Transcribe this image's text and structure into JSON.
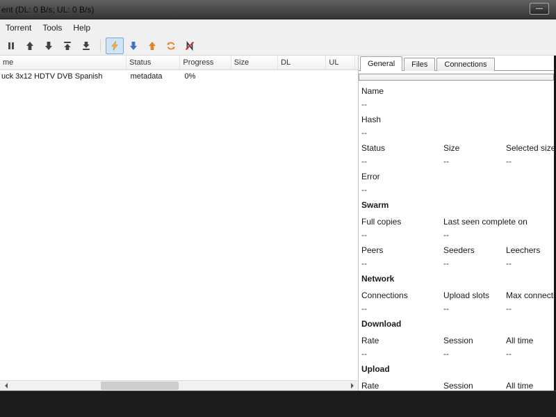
{
  "window": {
    "title": "ent (DL: 0 B/s; UL: 0 B/s)",
    "minimize_glyph": "—"
  },
  "menu": {
    "items": [
      "Torrent",
      "Tools",
      "Help"
    ]
  },
  "toolbar": {
    "buttons": [
      {
        "name": "pause-button",
        "icon": "pause-icon",
        "pressed": false
      },
      {
        "name": "queue-up-button",
        "icon": "arrow-up-icon",
        "pressed": false
      },
      {
        "name": "queue-down-button",
        "icon": "arrow-down-icon",
        "pressed": false
      },
      {
        "name": "queue-top-button",
        "icon": "arrow-top-icon",
        "pressed": false
      },
      {
        "name": "queue-bottom-button",
        "icon": "arrow-bottom-icon",
        "pressed": false
      },
      {
        "name": "turbo-toggle-button",
        "icon": "lightning-icon",
        "pressed": true
      },
      {
        "name": "download-button",
        "icon": "blue-down-arrow-icon",
        "pressed": false
      },
      {
        "name": "upload-button",
        "icon": "orange-up-arrow-icon",
        "pressed": false
      },
      {
        "name": "reannounce-button",
        "icon": "refresh-icon",
        "pressed": false
      },
      {
        "name": "remove-button",
        "icon": "ban-icon",
        "pressed": false
      }
    ]
  },
  "torrents": {
    "columns": [
      "me",
      "Status",
      "Progress",
      "Size",
      "DL",
      "UL"
    ],
    "rows": [
      {
        "name": "uck 3x12 HDTV DVB Spanish",
        "status": "metadata",
        "progress": "0%",
        "size": "",
        "dl": "",
        "ul": ""
      }
    ]
  },
  "details": {
    "tabs": [
      "General",
      "Files",
      "Connections"
    ],
    "active_tab": "General",
    "progress_percent": 0,
    "general": {
      "name_label": "Name",
      "name_value": "--",
      "hash_label": "Hash",
      "hash_value": "--",
      "status_label": "Status",
      "status_value": "--",
      "size_label": "Size",
      "size_value": "--",
      "selected_size_label": "Selected size",
      "selected_size_value": "--",
      "error_label": "Error",
      "error_value": "--",
      "swarm_header": "Swarm",
      "full_copies_label": "Full copies",
      "full_copies_value": "--",
      "last_seen_label": "Last seen complete on",
      "last_seen_value": "--",
      "peers_label": "Peers",
      "peers_value": "--",
      "seeders_label": "Seeders",
      "seeders_value": "--",
      "leechers_label": "Leechers",
      "leechers_value": "--",
      "network_header": "Network",
      "connections_label": "Connections",
      "connections_value": "--",
      "upload_slots_label": "Upload slots",
      "upload_slots_value": "--",
      "max_connections_label": "Max connections",
      "max_connections_value": "--",
      "download_header": "Download",
      "dl_rate_label": "Rate",
      "dl_rate_value": "--",
      "dl_session_label": "Session",
      "dl_session_value": "--",
      "dl_alltime_label": "All time",
      "dl_alltime_value": "--",
      "upload_header": "Upload",
      "ul_rate_label": "Rate",
      "ul_rate_value": "",
      "ul_session_label": "Session",
      "ul_session_value": "",
      "ul_alltime_label": "All time",
      "ul_alltime_value": ""
    }
  },
  "colors": {
    "pressed_button_bg": "#cfe4f8",
    "arrow_blue": "#3b74c9",
    "arrow_orange": "#e2862b",
    "lightning_yellow": "#f5b63d",
    "ban_red": "#cf2b2b",
    "titlebar_dark": "#343434"
  }
}
